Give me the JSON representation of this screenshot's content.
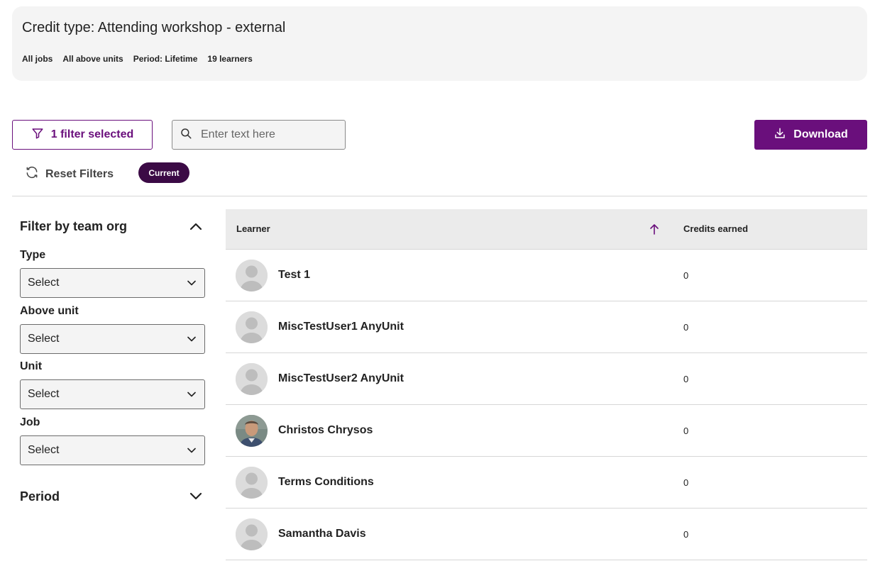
{
  "summary": {
    "title": "Credit type: Attending workshop - external",
    "meta": [
      "All jobs",
      "All above units",
      "Period: Lifetime",
      "19 learners"
    ]
  },
  "toolbar": {
    "filter_label": "1 filter selected",
    "search_placeholder": "Enter text here",
    "download_label": "Download",
    "reset_label": "Reset Filters",
    "current_pill": "Current"
  },
  "sidebar": {
    "heading": "Filter by team org",
    "filters": [
      {
        "label": "Type",
        "value": "Select"
      },
      {
        "label": "Above unit",
        "value": "Select"
      },
      {
        "label": "Unit",
        "value": "Select"
      },
      {
        "label": "Job",
        "value": "Select"
      }
    ],
    "period_heading": "Period"
  },
  "table": {
    "columns": {
      "learner": "Learner",
      "credits": "Credits earned"
    },
    "rows": [
      {
        "name": "Test 1",
        "credits": "0",
        "avatar": "placeholder-avatar"
      },
      {
        "name": "MiscTestUser1 AnyUnit",
        "credits": "0",
        "avatar": "placeholder-avatar"
      },
      {
        "name": "MiscTestUser2 AnyUnit",
        "credits": "0",
        "avatar": "placeholder-avatar"
      },
      {
        "name": "Christos Chrysos",
        "credits": "0",
        "avatar": "photo-avatar"
      },
      {
        "name": "Terms Conditions",
        "credits": "0",
        "avatar": "placeholder-avatar"
      },
      {
        "name": "Samantha Davis",
        "credits": "0",
        "avatar": "placeholder-avatar"
      }
    ]
  },
  "colors": {
    "accent": "#6a0f7c",
    "pill": "#3b0a45",
    "card_bg": "#f4f4f4",
    "header_bg": "#ebebeb"
  }
}
